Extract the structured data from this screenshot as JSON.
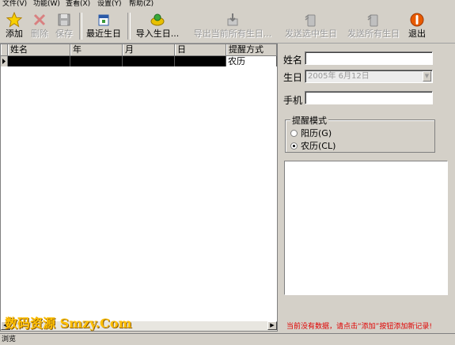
{
  "menu": {
    "items": [
      "文件(V)",
      "功能(W)",
      "查看(X)",
      "设置(Y)",
      "帮助(Z)"
    ]
  },
  "toolbar": {
    "add_label": "添加",
    "delete_label": "删除",
    "save_label": "保存",
    "recent_label": "最近生日",
    "import_label": "导入生日...",
    "export_label": "导出当前所有生日...",
    "send_selected_label": "发送选中生日",
    "send_all_label": "发送所有生日",
    "exit_label": "退出"
  },
  "grid": {
    "columns": [
      "姓名",
      "年",
      "月",
      "日",
      "提醒方式"
    ],
    "rows": [
      {
        "name": "",
        "year": "",
        "month": "",
        "day": "",
        "mode": "农历"
      }
    ]
  },
  "form": {
    "name_label": "姓名",
    "birthday_label": "生日",
    "birthday_value": "2005年 6月12日",
    "phone_label": "手机",
    "name_value": "",
    "phone_value": "",
    "mode_group_title": "提醒模式",
    "mode_options": [
      "阳历(G)",
      "农历(CL)"
    ],
    "mode_selected": "农历(CL)"
  },
  "hint_text": "当前没有数据，请点击“添加”按钮添加新记录!",
  "watermark_text": "数码资源 Smzy.Com",
  "status_text": "浏览",
  "colors": {
    "hint": "#e00000",
    "selected_row": "#000000",
    "watermark": "#ffbf00"
  }
}
